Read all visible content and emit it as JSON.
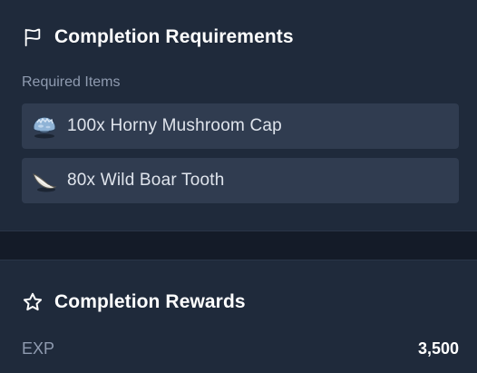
{
  "requirements": {
    "title": "Completion Requirements",
    "icon": "flag-icon",
    "subheading": "Required Items",
    "items": [
      {
        "label": "100x Horny Mushroom Cap",
        "icon": "mushroom-cap-icon"
      },
      {
        "label": "80x Wild Boar Tooth",
        "icon": "boar-tooth-icon"
      }
    ]
  },
  "rewards": {
    "title": "Completion Rewards",
    "icon": "star-icon",
    "exp_label": "EXP",
    "exp_value": "3,500"
  },
  "colors": {
    "background": "#141b28",
    "panel": "#1f2a3b",
    "item_row": "#303c50",
    "muted_text": "#8f9bb0",
    "title_text": "#ffffff"
  }
}
